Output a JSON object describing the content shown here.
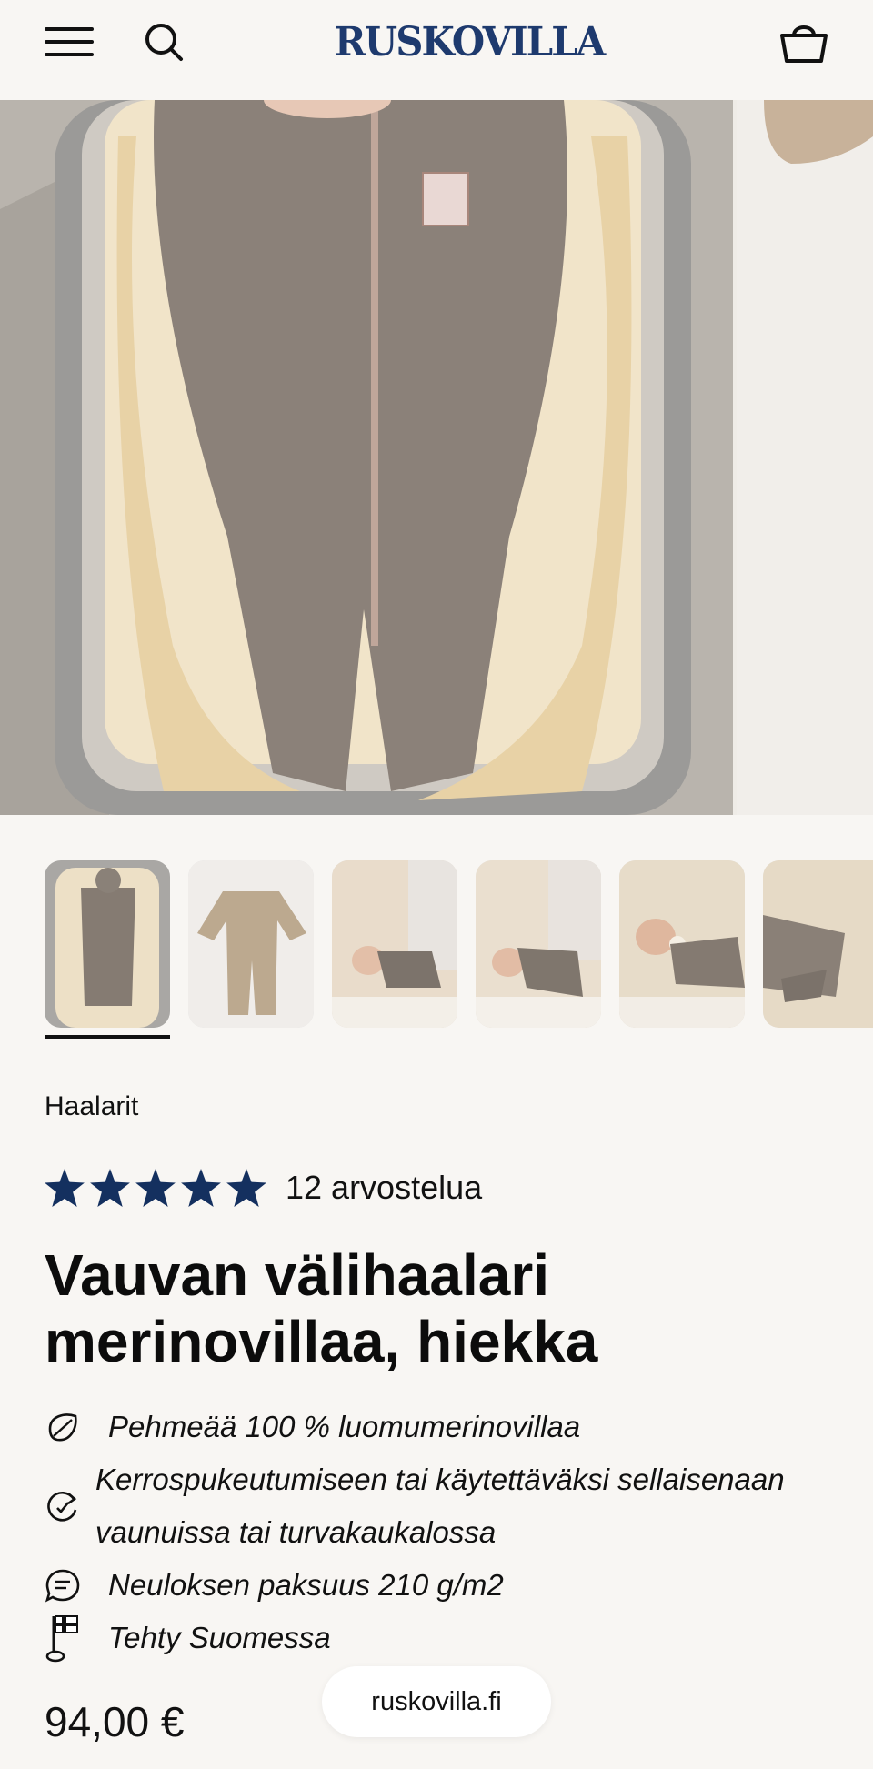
{
  "header": {
    "logo_text": "RUSKOVILLA",
    "menu_icon": "menu-icon",
    "search_icon": "search-icon",
    "cart_icon": "cart-icon"
  },
  "gallery": {
    "thumbnail_count": 6,
    "selected_index": 0
  },
  "product": {
    "category": "Haalarit",
    "rating_stars": 5,
    "rating_text": "12 arvostelua",
    "title": "Vauvan välihaalari merinovillaa, hiekka",
    "features": [
      {
        "icon": "leaf-icon",
        "text": "Pehmeää 100 % luomumerinovillaa"
      },
      {
        "icon": "refresh-icon",
        "text": "Kerrospukeutumiseen tai käytettäväksi sellaisenaan vaunuissa tai turvakaukalossa"
      },
      {
        "icon": "chat-icon",
        "text": "Neuloksen paksuus 210 g/m2"
      },
      {
        "icon": "finnish-flag-icon",
        "text": "Tehty Suomessa"
      }
    ],
    "price": "94,00 €"
  },
  "browser": {
    "domain": "ruskovilla.fi"
  },
  "colors": {
    "background": "#f8f6f3",
    "brand_blue": "#1e3a6e",
    "star": "#14305f",
    "text": "#111111"
  }
}
